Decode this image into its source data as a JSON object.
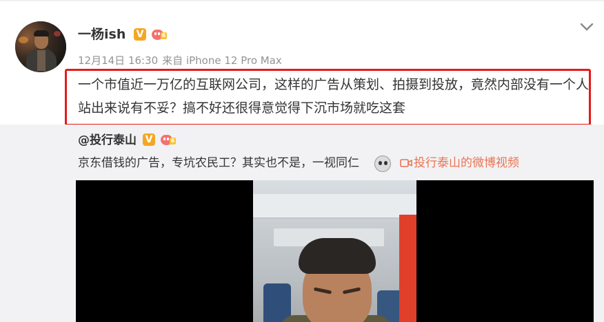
{
  "post": {
    "username": "一杨ish",
    "verified_badge": "V",
    "timestamp": "12月14日 16:30",
    "source": "来自 iPhone 12 Pro Max",
    "text": "一个市值近一万亿的互联网公司，这样的广告从策划、拍摄到投放，竟然内部没有一个人站出来说有不妥？搞不好还很得意觉得下沉市场就吃这套",
    "menu_icon": "chevron-down-icon"
  },
  "repost": {
    "username": "@投行泰山",
    "verified_badge": "V",
    "text": "京东借钱的广告，专坑农民工？其实也不是，一视同仁",
    "emoji_icon": "doge-emoji-icon",
    "video_link": "投行泰山的微博视频",
    "video_link_icon": "video-camera-icon"
  },
  "colors": {
    "highlight_border": "#e61919",
    "verified_orange": "#f5a623",
    "link_orange": "#eb7350",
    "repost_background": "#f2f2f5",
    "meta_gray": "#939393"
  }
}
